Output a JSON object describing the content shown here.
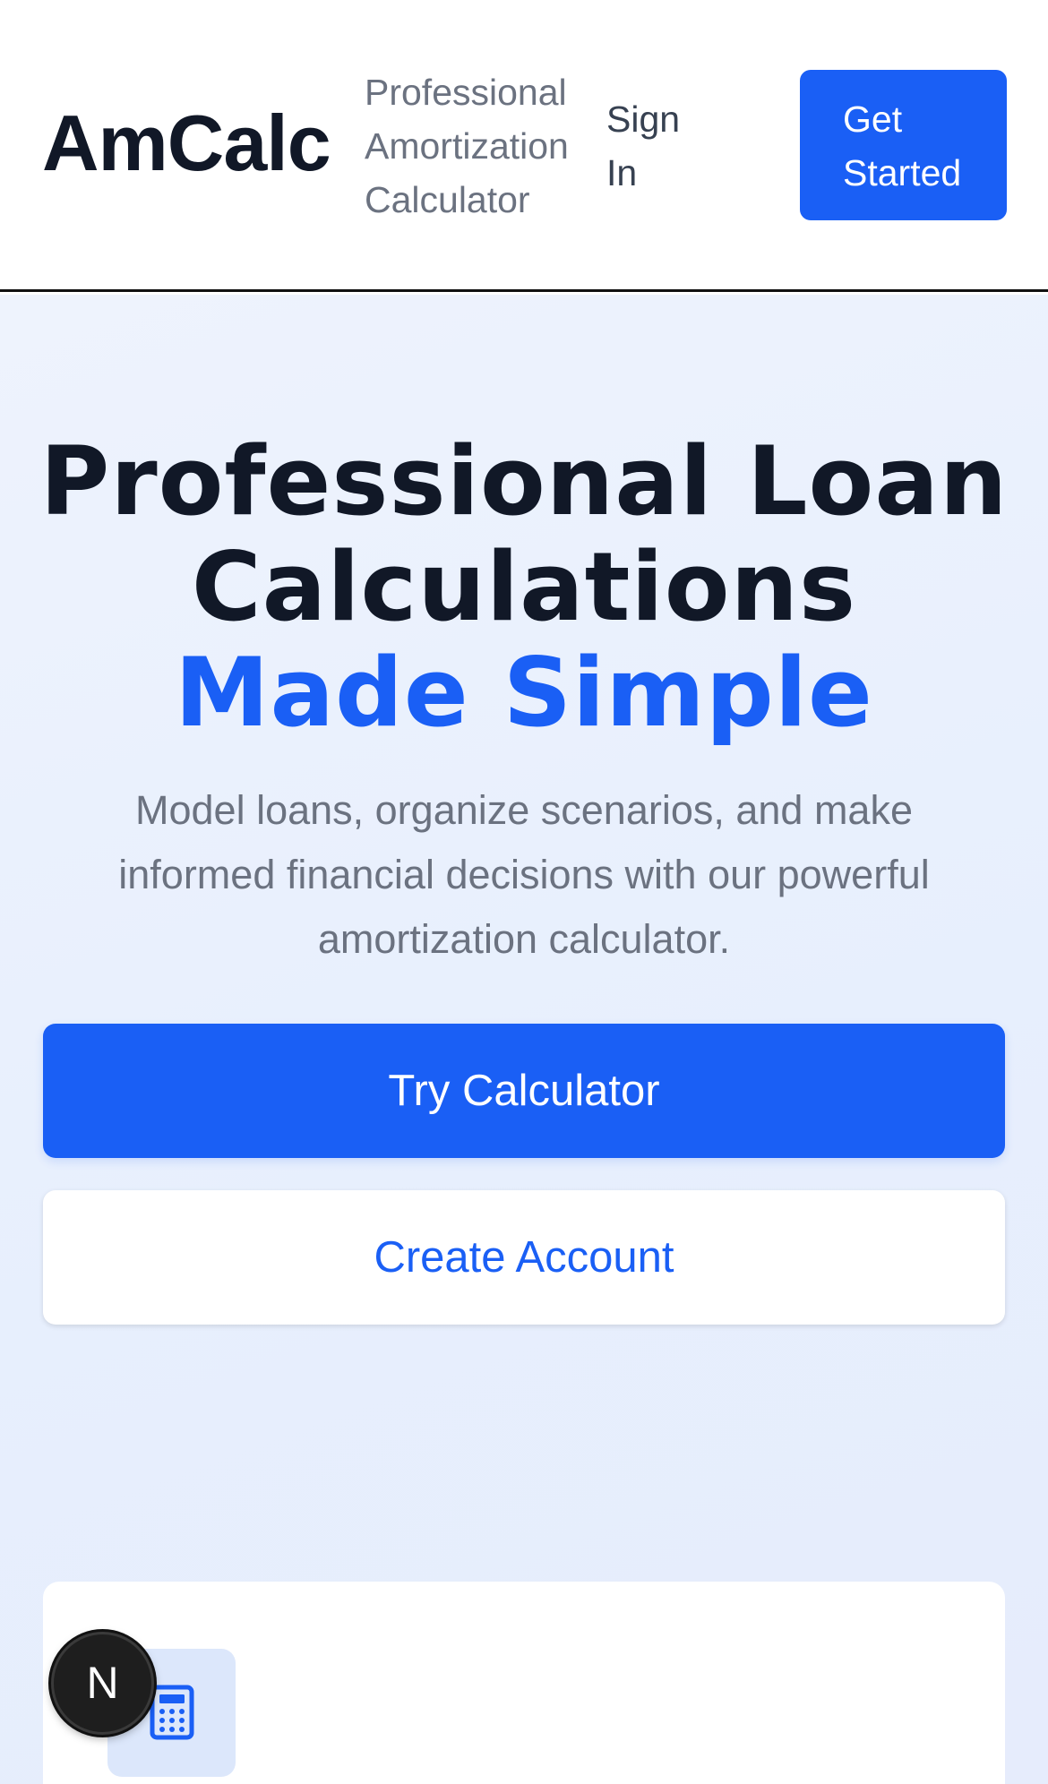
{
  "header": {
    "logo": "AmCalc",
    "tagline": "Professional Amortization Calculator",
    "sign_in": "Sign In",
    "get_started": "Get Started"
  },
  "hero": {
    "title_line": "Professional Loan Calculations",
    "title_accent": "Made Simple",
    "subtitle": "Model loans, organize scenarios, and make informed financial decisions with our powerful amortization calculator.",
    "primary_button": "Try Calculator",
    "secondary_button": "Create Account"
  },
  "feature_card": {
    "icon": "calculator-icon"
  },
  "floating_badge": {
    "label": "N"
  },
  "colors": {
    "brand": "#1a5ff5",
    "heading": "#111827",
    "muted": "#6b7280",
    "hero_bg": "#e9f0fd"
  }
}
